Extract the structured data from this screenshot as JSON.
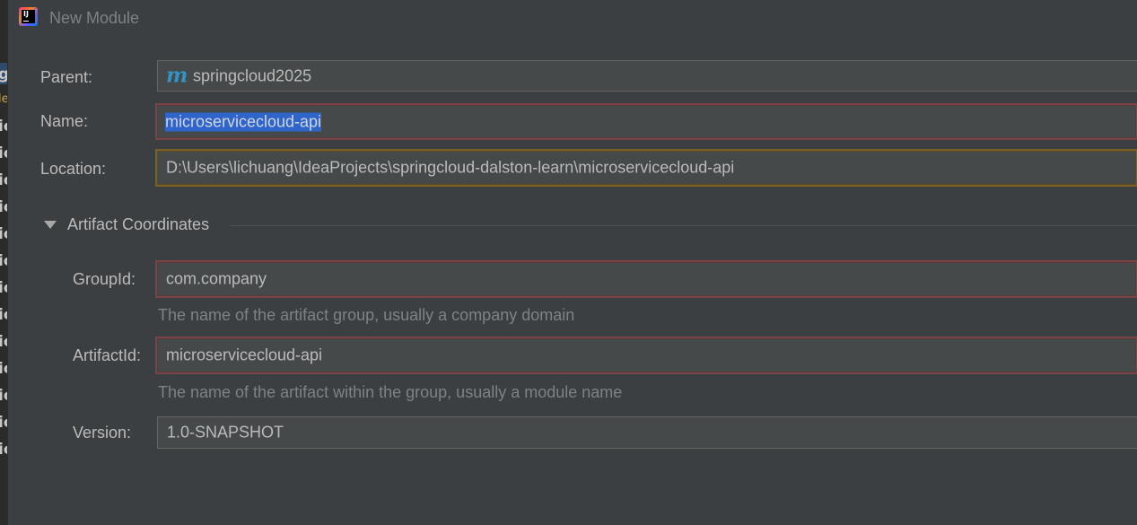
{
  "window": {
    "title": "New Module",
    "app_icon_text": "IJ"
  },
  "background_fragments": {
    "chars": [
      "g",
      "le",
      "ic",
      "ic",
      "ic",
      "ic",
      "ic",
      "ic",
      "ic",
      "ic",
      "ic",
      "ic",
      "ic",
      "ic",
      "ic",
      "ic"
    ]
  },
  "form": {
    "parent_label": "Parent:",
    "parent_value": "springcloud2025",
    "name_label": "Name:",
    "name_value": "microservicecloud-api",
    "location_label": "Location:",
    "location_value": "D:\\Users\\lichuang\\IdeaProjects\\springcloud-dalston-learn\\microservicecloud-api"
  },
  "artifact": {
    "section_title": "Artifact Coordinates",
    "groupid_label": "GroupId:",
    "groupid_value": "com.company",
    "groupid_hint": "The name of the artifact group, usually a company domain",
    "artifactid_label": "ArtifactId:",
    "artifactid_value": "microservicecloud-api",
    "artifactid_hint": "The name of the artifact within the group, usually a module name",
    "version_label": "Version:",
    "version_value": "1.0-SNAPSHOT"
  },
  "colors": {
    "background": "#3c3f41",
    "field_bg": "#45494a",
    "error_border": "#7a4345",
    "warning_border": "#7d6124",
    "selection": "#2f65ca",
    "maven_icon": "#3592c4"
  }
}
